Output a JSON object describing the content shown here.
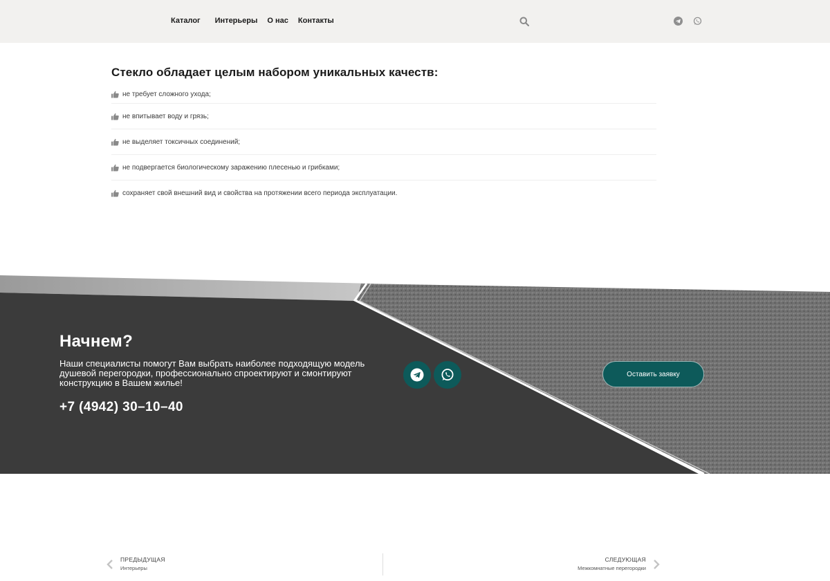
{
  "header": {
    "nav": [
      {
        "label": "Каталог"
      },
      {
        "label": "Интерьеры"
      },
      {
        "label": "О нас"
      },
      {
        "label": "Контакты"
      }
    ],
    "icons": [
      "search-icon",
      "telegram-icon",
      "whatsapp-icon"
    ]
  },
  "content": {
    "heading": "Стекло обладает целым набором уникальных качеств:",
    "items": [
      "не требует сложного ухода;",
      "не впитывает воду и грязь;",
      "не выделяет токсичных соединений;",
      "не подвергается биологическому заражению плесенью и грибками;",
      "сохраняет свой внешний вид и свойства на протяжении всего периода эксплуатации."
    ],
    "item_icon": "thumbs-up-icon"
  },
  "cta": {
    "title": "Начнем?",
    "text": "Наши специалисты помогут Вам выбрать наиболее подходящую модель душевой перегородки, профессионально спроектируют и смонтируют конструкцию в Вашем жилье!",
    "phone": "+7 (4942) 30–10–40",
    "button": "Оставить заявку",
    "icons": [
      "telegram-icon",
      "whatsapp-icon"
    ],
    "accent": "#0d5a5a"
  },
  "postnav": {
    "prev": {
      "label": "ПРЕДЫДУЩАЯ",
      "title": "Интерьеры"
    },
    "next": {
      "label": "СЛЕДУЮЩАЯ",
      "title": "Межкомнатные перегородки"
    }
  },
  "colors": {
    "header_bg": "#f2f1ef",
    "banner_dark": "#3a3a3a",
    "accent": "#0d5a5a"
  }
}
